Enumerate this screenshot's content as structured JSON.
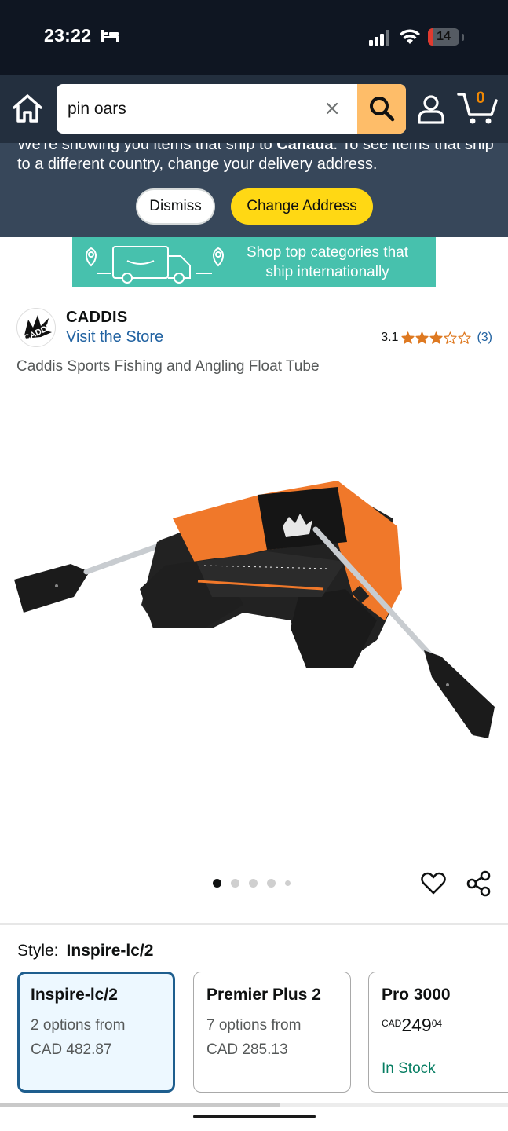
{
  "status_bar": {
    "time": "23:22",
    "battery": "14",
    "battery_level": 0.14,
    "icons": [
      "bed-icon",
      "signal-icon",
      "wifi-icon",
      "battery-icon"
    ]
  },
  "header": {
    "search_value": "pin oars",
    "cart_count": "0",
    "icons": [
      "home-icon",
      "clear-icon",
      "search-icon",
      "account-icon",
      "cart-icon"
    ],
    "colors": {
      "background": "#232f3e",
      "search_button": "#febd69",
      "cart_count": "#f08804"
    }
  },
  "delivery_banner": {
    "text_prefix": "We're showing you items that ship to ",
    "country": "Canada",
    "text_suffix": ". To see items that ship to a different country, change your delivery address.",
    "dismiss_label": "Dismiss",
    "change_address_label": "Change Address",
    "colors": {
      "background": "#37475a",
      "primary_button": "#ffd814"
    }
  },
  "promo": {
    "line1": "Shop top categories that",
    "line2": "ship internationally",
    "color": "#47c1ad"
  },
  "product": {
    "brand": "CADDIS",
    "brand_logo_text": "CADDIS",
    "visit_store": "Visit the Store",
    "rating": "3.1",
    "rating_stars": 3.1,
    "rating_count": "(3)",
    "title": "Caddis Sports Fishing and Angling Float Tube",
    "image_count": 5,
    "active_image": 1
  },
  "style": {
    "label": "Style:",
    "selected": "Inspire-lc/2",
    "options": [
      {
        "name": "Inspire-lc/2",
        "line1": "2 options from",
        "line2": "CAD 482.87"
      },
      {
        "name": "Premier Plus 2",
        "line1": "7 options from",
        "line2": "CAD 285.13"
      },
      {
        "name": "Pro 3000",
        "price_currency": "CAD",
        "price_whole": "249",
        "price_fraction": "04",
        "stock": "In Stock"
      }
    ]
  }
}
